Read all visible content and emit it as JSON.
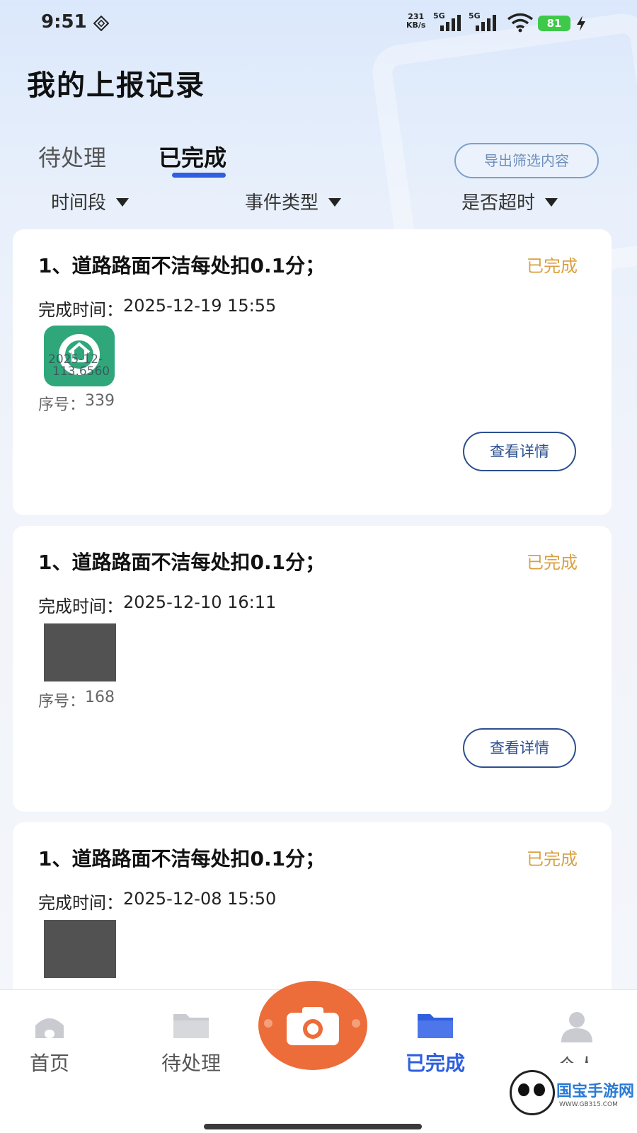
{
  "status_bar": {
    "time": "9:51",
    "net_speed_value": "231",
    "net_speed_unit": "KB/s",
    "sim1_label": "5G",
    "sim2_label": "5G",
    "wifi_level": "6",
    "battery": "81",
    "icons": [
      "vpn-icon",
      "signal-icon",
      "wifi-icon",
      "battery-icon",
      "charging-icon"
    ]
  },
  "header": {
    "title": "我的上报记录"
  },
  "tabs": [
    {
      "label": "待处理",
      "active": false
    },
    {
      "label": "已完成",
      "active": true
    }
  ],
  "export_button": "导出筛选内容",
  "filters": [
    {
      "label": "时间段"
    },
    {
      "label": "事件类型"
    },
    {
      "label": "是否超时"
    }
  ],
  "records": [
    {
      "title": "1、道路路面不洁每处扣0.1分；",
      "status": "已完成",
      "time_label": "完成时间：",
      "time": "2025-12-19 15:55",
      "thumb_watermark_line1": "2025-12-",
      "thumb_watermark_line2": "113.6560",
      "seq_label": "序号：",
      "seq": "339",
      "detail_button": "查看详情"
    },
    {
      "title": "1、道路路面不洁每处扣0.1分；",
      "status": "已完成",
      "time_label": "完成时间：",
      "time": "2025-12-10 16:11",
      "seq_label": "序号：",
      "seq": "168",
      "detail_button": "查看详情"
    },
    {
      "title": "1、道路路面不洁每处扣0.1分；",
      "status": "已完成",
      "time_label": "完成时间：",
      "time": "2025-12-08 15:50"
    }
  ],
  "bottom_nav": [
    {
      "label": "首页",
      "icon": "home-icon",
      "active": false
    },
    {
      "label": "待处理",
      "icon": "folder-icon",
      "active": false
    },
    {
      "label": "",
      "icon": "camera-icon",
      "active": false
    },
    {
      "label": "已完成",
      "icon": "folder-icon",
      "active": true
    },
    {
      "label": "个人",
      "icon": "user-icon",
      "active": false
    }
  ],
  "watermark": {
    "brand": "国宝手游网",
    "url": "WWW.GB315.COM"
  },
  "colors": {
    "accent": "#2f5fe0",
    "status_done": "#d9a043",
    "camera": "#ec6c3a",
    "detail_button": "#2d4f8f"
  }
}
